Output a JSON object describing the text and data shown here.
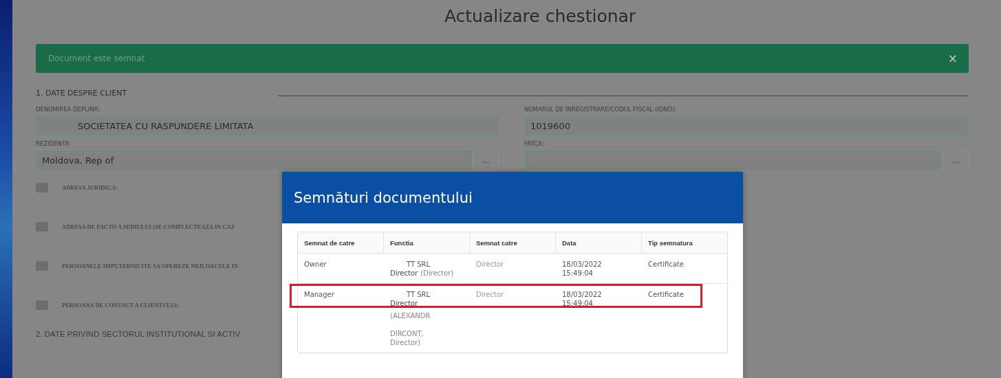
{
  "page_title": "Actualizare chestionar",
  "alert": {
    "message": "Document este semnat",
    "close": "×"
  },
  "section_1": {
    "heading": "1. DATE DESPRE CLIENT",
    "fields": [
      {
        "label": "DENUMIREA DEPLINA:",
        "value": "SOCIETATEA CU RASPUNDERE LIMITATA",
        "kind": "text"
      },
      {
        "label": "NUMARUL DE INREGISTRARE/CODUL FISCAL (IDNO):",
        "value": "1019600",
        "kind": "text"
      },
      {
        "label": "REZIDENTA:",
        "value": "Moldova, Rep of",
        "kind": "picker",
        "button": "..."
      },
      {
        "label": "FATCA:",
        "kind": "picker",
        "button": "..."
      }
    ],
    "collapsibles": [
      {
        "label": "ADRESA JURIDICA:",
        "expanded": false
      },
      {
        "label": "ADRESA DE FACTO A SEDIULUI (SE COMPLECTEAZA IN CAZ",
        "expanded": false
      },
      {
        "label": "PERSOANELE IMPUTERNICITE SA OPEREZE MIJLOACELE IN",
        "expanded": false
      },
      {
        "label": "PERSOANA DE CONTACT A CLIENTULUI:",
        "expanded": false
      }
    ]
  },
  "section_2": {
    "heading": "2. DATE PRIVIND SECTORUL INSTITUTIONAL SI ACTIV"
  },
  "modal": {
    "title": "Semnături documentului",
    "table": {
      "columns": [
        "Semnat de catre",
        "Functia",
        "Semnat catre",
        "Data",
        "Tip semnatura"
      ],
      "rows": [
        {
          "signed_by": "Owner",
          "functia": {
            "company": "TT SRL",
            "lines": [
              [
                {
                  "text": "Director",
                  "muted": false
                },
                {
                  "text": "(Director)",
                  "muted": true
                }
              ]
            ]
          },
          "signed_as": "Director",
          "date": "18/03/2022",
          "time": "15:49:04",
          "type": "Certificate",
          "highlighted": false
        },
        {
          "signed_by": "Manager",
          "functia": {
            "company": "TT SRL",
            "lines": [
              [
                {
                  "text": "Director",
                  "muted": false
                }
              ],
              [
                {
                  "text": "(ALEXANDR",
                  "muted": true
                }
              ],
              [
                {
                  "text": "DIRCONT,",
                  "muted": true
                }
              ],
              [
                {
                  "text": "Director)",
                  "muted": true
                }
              ]
            ]
          },
          "signed_as": "Director",
          "date": "18/03/2022",
          "time": "15:49:04",
          "type": "Certificate",
          "highlighted": true
        }
      ]
    }
  }
}
